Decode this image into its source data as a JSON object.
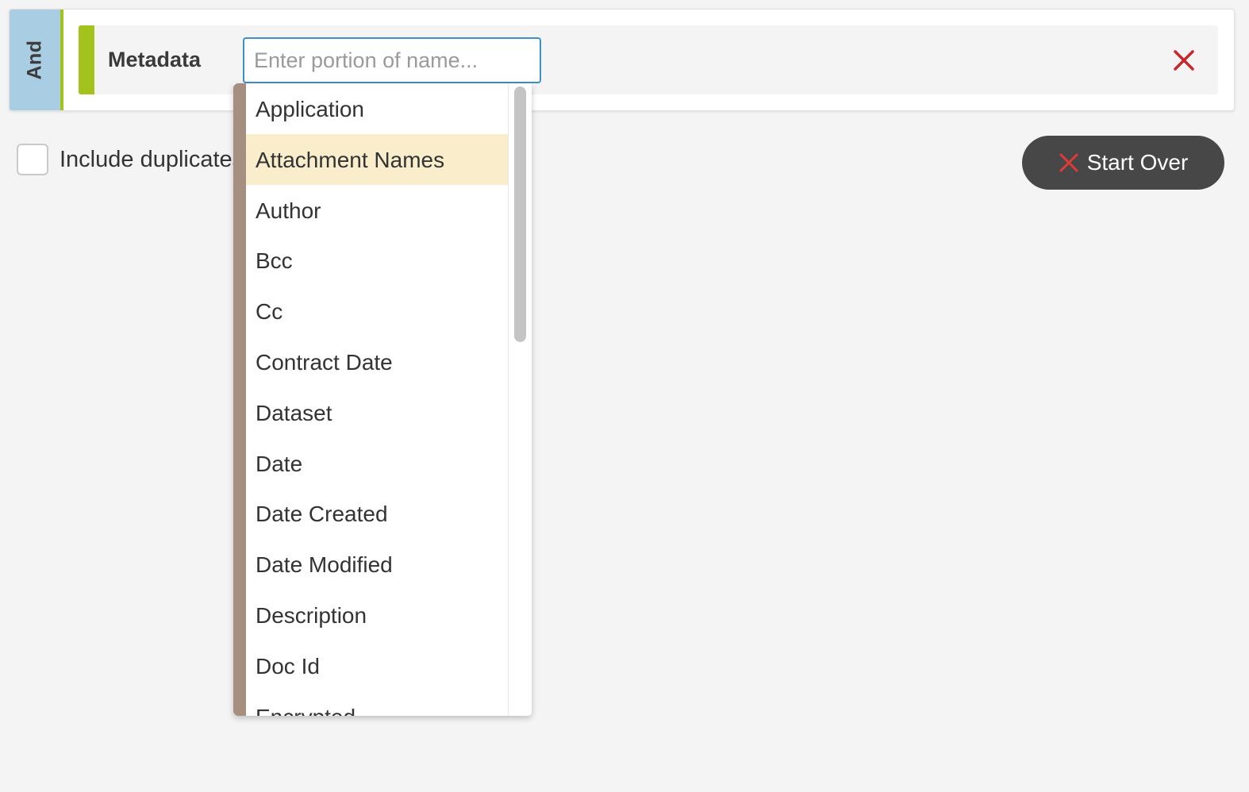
{
  "query": {
    "operator_label": "And",
    "condition": {
      "label": "Metadata",
      "input_placeholder": "Enter portion of name...",
      "input_value": ""
    }
  },
  "options": {
    "include_duplicates_label": "Include duplicates",
    "include_duplicates_checked": false
  },
  "actions": {
    "start_over_label": "Start Over"
  },
  "dropdown": {
    "highlighted_index": 1,
    "items": [
      {
        "label": "Application"
      },
      {
        "label": "Attachment Names"
      },
      {
        "label": "Author"
      },
      {
        "label": "Bcc"
      },
      {
        "label": "Cc"
      },
      {
        "label": "Contract Date"
      },
      {
        "label": "Dataset"
      },
      {
        "label": "Date"
      },
      {
        "label": "Date Created"
      },
      {
        "label": "Date Modified"
      },
      {
        "label": "Description"
      },
      {
        "label": "Doc Id"
      },
      {
        "label": "Encrypted"
      }
    ]
  },
  "icons": {
    "remove_condition": "close-icon",
    "start_over": "close-icon"
  },
  "colors": {
    "and_tab": "#a9cde3",
    "condition_accent": "#a4c21c",
    "dropdown_accent": "#a48f80",
    "highlight": "#f9edcc",
    "remove_icon": "#c8262b",
    "start_over_bg": "#474747",
    "input_focus": "#3d8fc7"
  }
}
